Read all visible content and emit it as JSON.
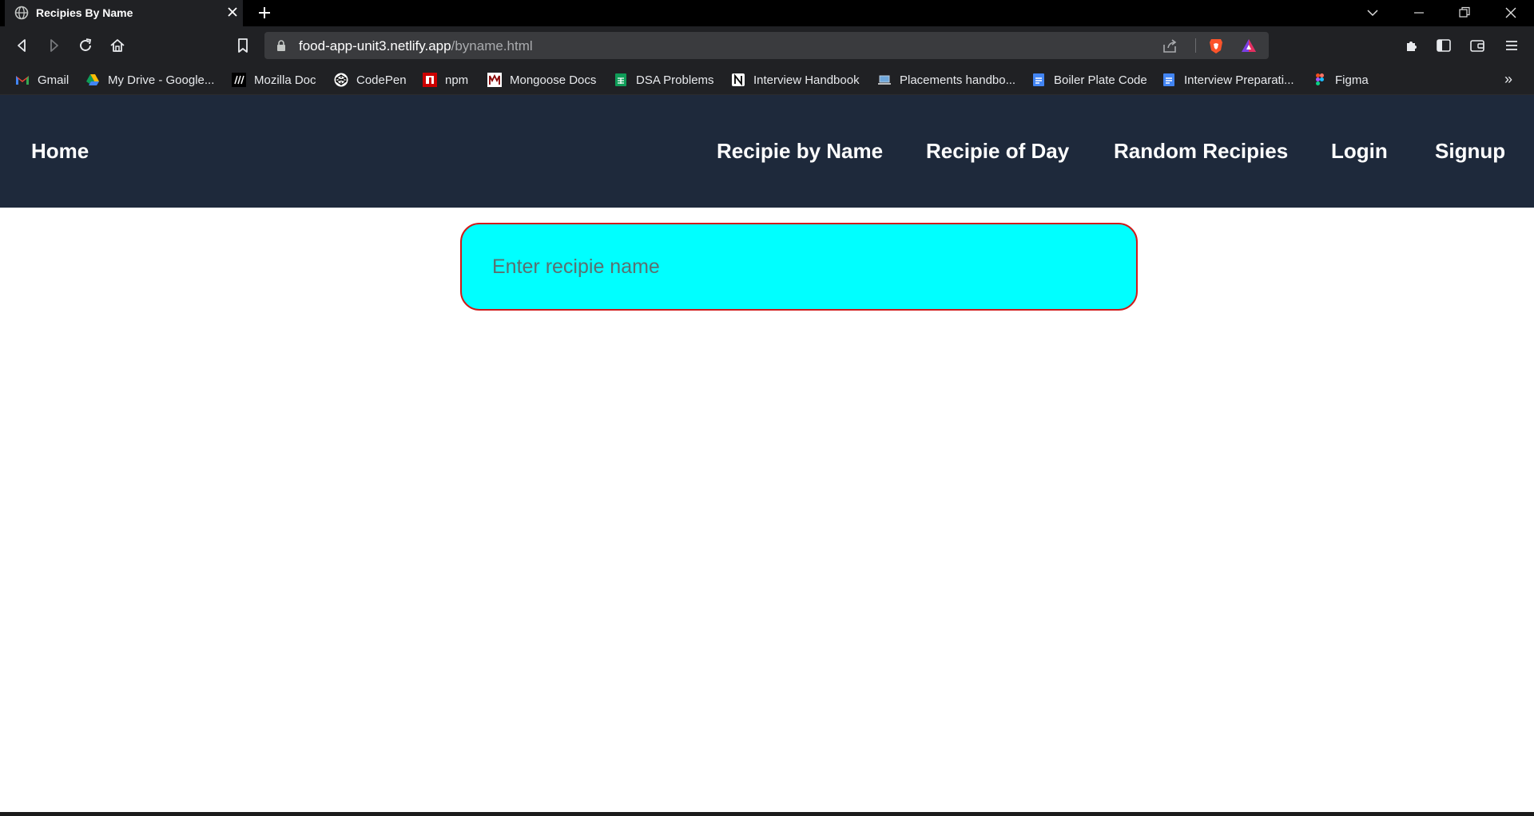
{
  "browser": {
    "tab_title": "Recipies By Name",
    "url_host": "food-app-unit3.netlify.app",
    "url_path": "/byname.html",
    "bookmarks": [
      {
        "label": "Gmail",
        "icon": "gmail-icon"
      },
      {
        "label": "My Drive - Google...",
        "icon": "google-drive-icon"
      },
      {
        "label": "Mozilla Doc",
        "icon": "mdn-icon"
      },
      {
        "label": "CodePen",
        "icon": "codepen-icon"
      },
      {
        "label": "npm",
        "icon": "npm-icon"
      },
      {
        "label": "Mongoose Docs",
        "icon": "mongoose-icon"
      },
      {
        "label": "DSA Problems",
        "icon": "sheets-icon"
      },
      {
        "label": "Interview Handbook",
        "icon": "notion-icon"
      },
      {
        "label": "Placements handbo...",
        "icon": "laptop-icon"
      },
      {
        "label": "Boiler Plate Code",
        "icon": "docs-icon"
      },
      {
        "label": "Interview Preparati...",
        "icon": "docs-icon"
      },
      {
        "label": "Figma",
        "icon": "figma-icon"
      }
    ],
    "more_bookmarks": "»"
  },
  "site": {
    "nav": {
      "home": "Home",
      "by_name": "Recipie by Name",
      "of_day": "Recipie of Day",
      "random": "Random Recipies",
      "login": "Login",
      "signup": "Signup"
    },
    "search": {
      "placeholder": "Enter recipie name",
      "value": ""
    }
  },
  "colors": {
    "nav_bg": "#1e293b",
    "search_bg": "#00ffff",
    "search_border": "#d11a1a"
  }
}
